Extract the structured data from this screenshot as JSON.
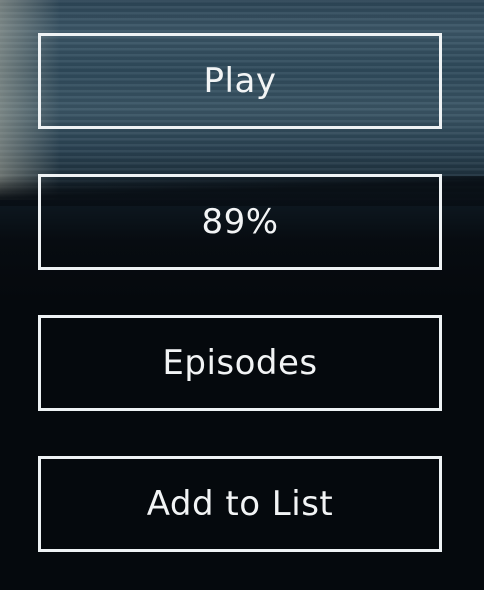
{
  "menu": {
    "play_label": "Play",
    "progress_label": "89%",
    "episodes_label": "Episodes",
    "add_to_list_label": "Add to List"
  },
  "colors": {
    "button_border": "#eef2f4",
    "button_text": "#f2f4f5",
    "background": "#05090d"
  }
}
